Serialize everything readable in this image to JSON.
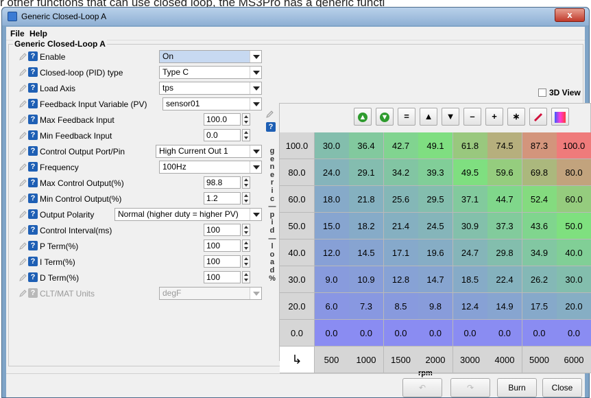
{
  "background_text": "r other functions that can use closed loop, the MS3Pro has a generic functi",
  "window": {
    "title": "Generic Closed-Loop A",
    "close_label": "x"
  },
  "menu": {
    "file": "File",
    "help": "Help"
  },
  "group_title": "Generic Closed-Loop A",
  "settings": [
    {
      "label": "Enable",
      "kind": "select",
      "value": "On",
      "selected": true
    },
    {
      "label": "Closed-loop (PID) type",
      "kind": "select",
      "value": "Type C"
    },
    {
      "label": "Load Axis",
      "kind": "select",
      "value": "tps"
    },
    {
      "label": "Feedback Input Variable (PV)",
      "kind": "select",
      "value": "sensor01"
    },
    {
      "label": "Max Feedback Input",
      "kind": "spin",
      "value": "100.0"
    },
    {
      "label": "Min Feedback Input",
      "kind": "spin",
      "value": "0.0"
    },
    {
      "label": "Control Output Port/Pin",
      "kind": "select",
      "value": "High Current Out 1"
    },
    {
      "label": "Frequency",
      "kind": "select",
      "value": "100Hz"
    },
    {
      "label": "Max Control Output(%)",
      "kind": "spin",
      "value": "98.8"
    },
    {
      "label": "Min Control Output(%)",
      "kind": "spin",
      "value": "1.2"
    },
    {
      "label": "Output Polarity",
      "kind": "select",
      "value": "Normal (higher duty = higher PV)"
    },
    {
      "label": "Control Interval(ms)",
      "kind": "spin",
      "value": "100"
    },
    {
      "label": "P Term(%)",
      "kind": "spin",
      "value": "100"
    },
    {
      "label": "I Term(%)",
      "kind": "spin",
      "value": "100"
    },
    {
      "label": "D Term(%)",
      "kind": "spin",
      "value": "100"
    },
    {
      "label": "CLT/MAT Units",
      "kind": "select",
      "value": "degF",
      "disabled": true
    }
  ],
  "table": {
    "view3d_label": "3D View",
    "y_axis_label": "generic_pid_load%",
    "x_axis_label": "rpm",
    "corner_symbol": "↳",
    "toolbar": [
      "+",
      "+",
      "=",
      "▲",
      "▼",
      "–",
      "+",
      "∗",
      "/",
      "▦"
    ],
    "y_bins": [
      "100.0",
      "80.0",
      "60.0",
      "50.0",
      "40.0",
      "30.0",
      "20.0",
      "0.0"
    ],
    "x_bins": [
      "500",
      "1000",
      "1500",
      "2000",
      "3000",
      "4000",
      "5000",
      "6000"
    ],
    "rows": [
      [
        "30.0",
        "36.4",
        "42.7",
        "49.1",
        "61.8",
        "74.5",
        "87.3",
        "100.0"
      ],
      [
        "24.0",
        "29.1",
        "34.2",
        "39.3",
        "49.5",
        "59.6",
        "69.8",
        "80.0"
      ],
      [
        "18.0",
        "21.8",
        "25.6",
        "29.5",
        "37.1",
        "44.7",
        "52.4",
        "60.0"
      ],
      [
        "15.0",
        "18.2",
        "21.4",
        "24.5",
        "30.9",
        "37.3",
        "43.6",
        "50.0"
      ],
      [
        "12.0",
        "14.5",
        "17.1",
        "19.6",
        "24.7",
        "29.8",
        "34.9",
        "40.0"
      ],
      [
        "9.0",
        "10.9",
        "12.8",
        "14.7",
        "18.5",
        "22.4",
        "26.2",
        "30.0"
      ],
      [
        "6.0",
        "7.3",
        "8.5",
        "9.8",
        "12.4",
        "14.9",
        "17.5",
        "20.0"
      ],
      [
        "0.0",
        "0.0",
        "0.0",
        "0.0",
        "0.0",
        "0.0",
        "0.0",
        "0.0"
      ]
    ]
  },
  "buttons": {
    "undo": "↶",
    "redo": "↷",
    "burn": "Burn",
    "close": "Close"
  },
  "colors": {
    "low": "#8a8cf2",
    "mid": "#7fe07f",
    "high": "#ef7b7b"
  }
}
